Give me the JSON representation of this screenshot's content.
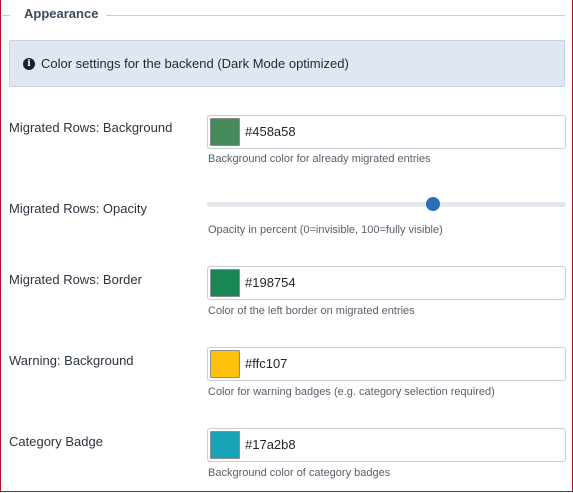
{
  "fieldset": {
    "legend": "Appearance"
  },
  "info": {
    "icon": "info-circle-icon",
    "text": "Color settings for the backend (Dark Mode optimized)"
  },
  "fields": {
    "migrated_bg": {
      "label": "Migrated Rows: Background",
      "value": "#458a58",
      "help": "Background color for already migrated entries"
    },
    "migrated_opacity": {
      "label": "Migrated Rows: Opacity",
      "value": 63,
      "min": 0,
      "max": 100,
      "help": "Opacity in percent (0=invisible, 100=fully visible)"
    },
    "migrated_border": {
      "label": "Migrated Rows: Border",
      "value": "#198754",
      "help": "Color of the left border on migrated entries"
    },
    "warning_bg": {
      "label": "Warning: Background",
      "value": "#ffc107",
      "help": "Color for warning badges (e.g. category selection required)"
    },
    "category_badge": {
      "label": "Category Badge",
      "value": "#17a2b8",
      "help": "Background color of category badges"
    }
  },
  "colors": {
    "frame_border": "#b5102a",
    "slider_thumb": "#2b6fb8",
    "info_background": "#dfe8f2"
  }
}
